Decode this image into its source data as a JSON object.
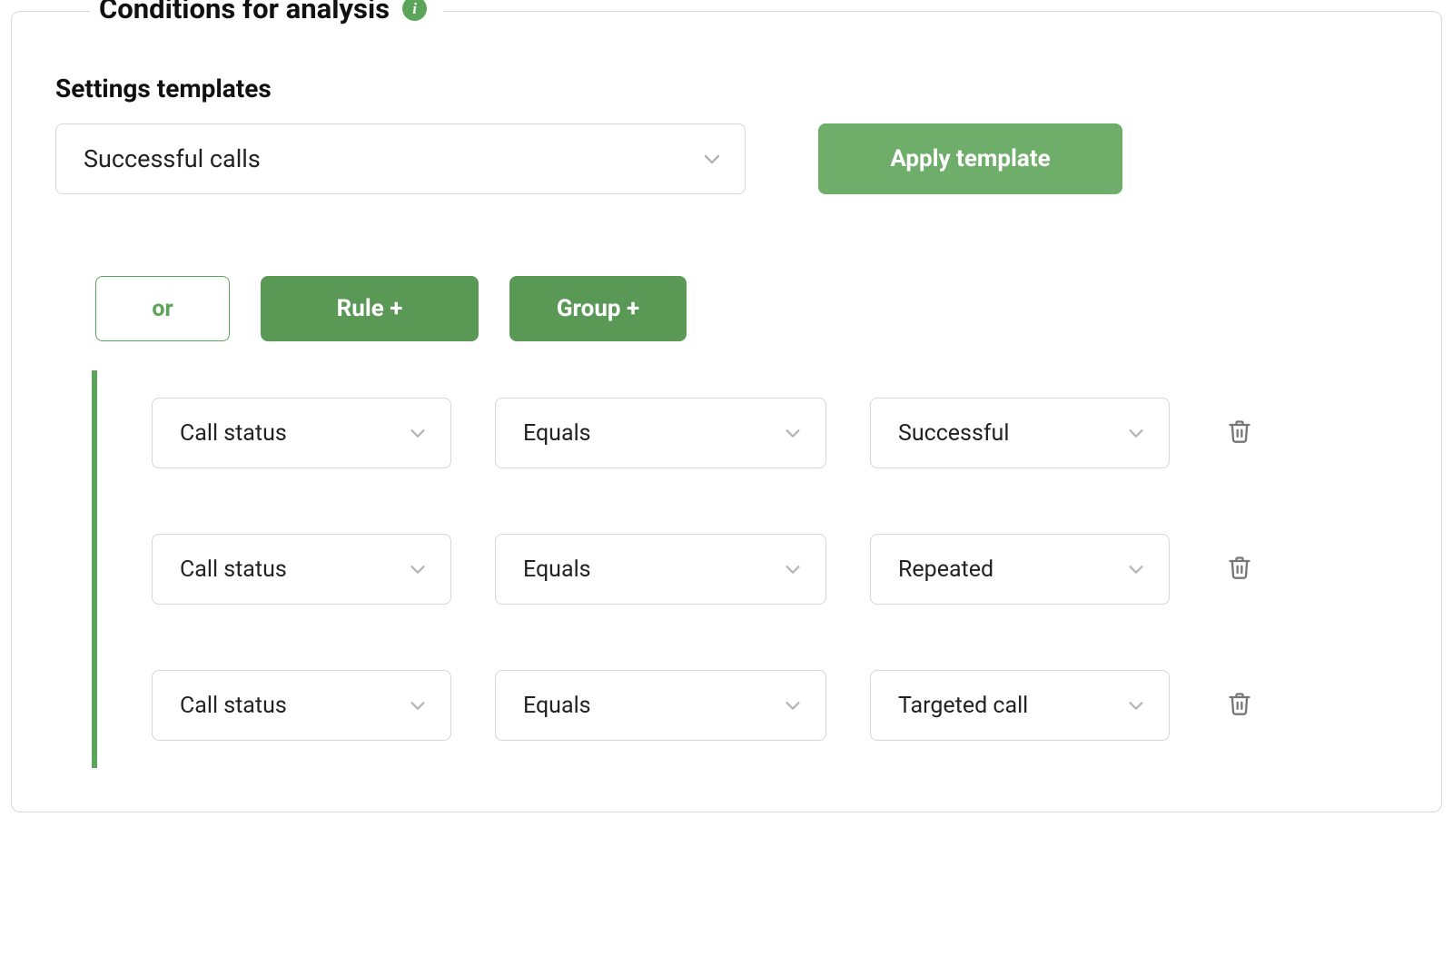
{
  "panel": {
    "title": "Conditions for analysis",
    "info_icon": "i"
  },
  "templates": {
    "heading": "Settings templates",
    "selected": "Successful calls",
    "apply_label": "Apply template"
  },
  "toolbar": {
    "or_label": "or",
    "rule_label": "Rule +",
    "group_label": "Group +"
  },
  "rules": [
    {
      "field": "Call status",
      "operator": "Equals",
      "value": "Successful"
    },
    {
      "field": "Call status",
      "operator": "Equals",
      "value": "Repeated"
    },
    {
      "field": "Call status",
      "operator": "Equals",
      "value": "Targeted call"
    }
  ]
}
